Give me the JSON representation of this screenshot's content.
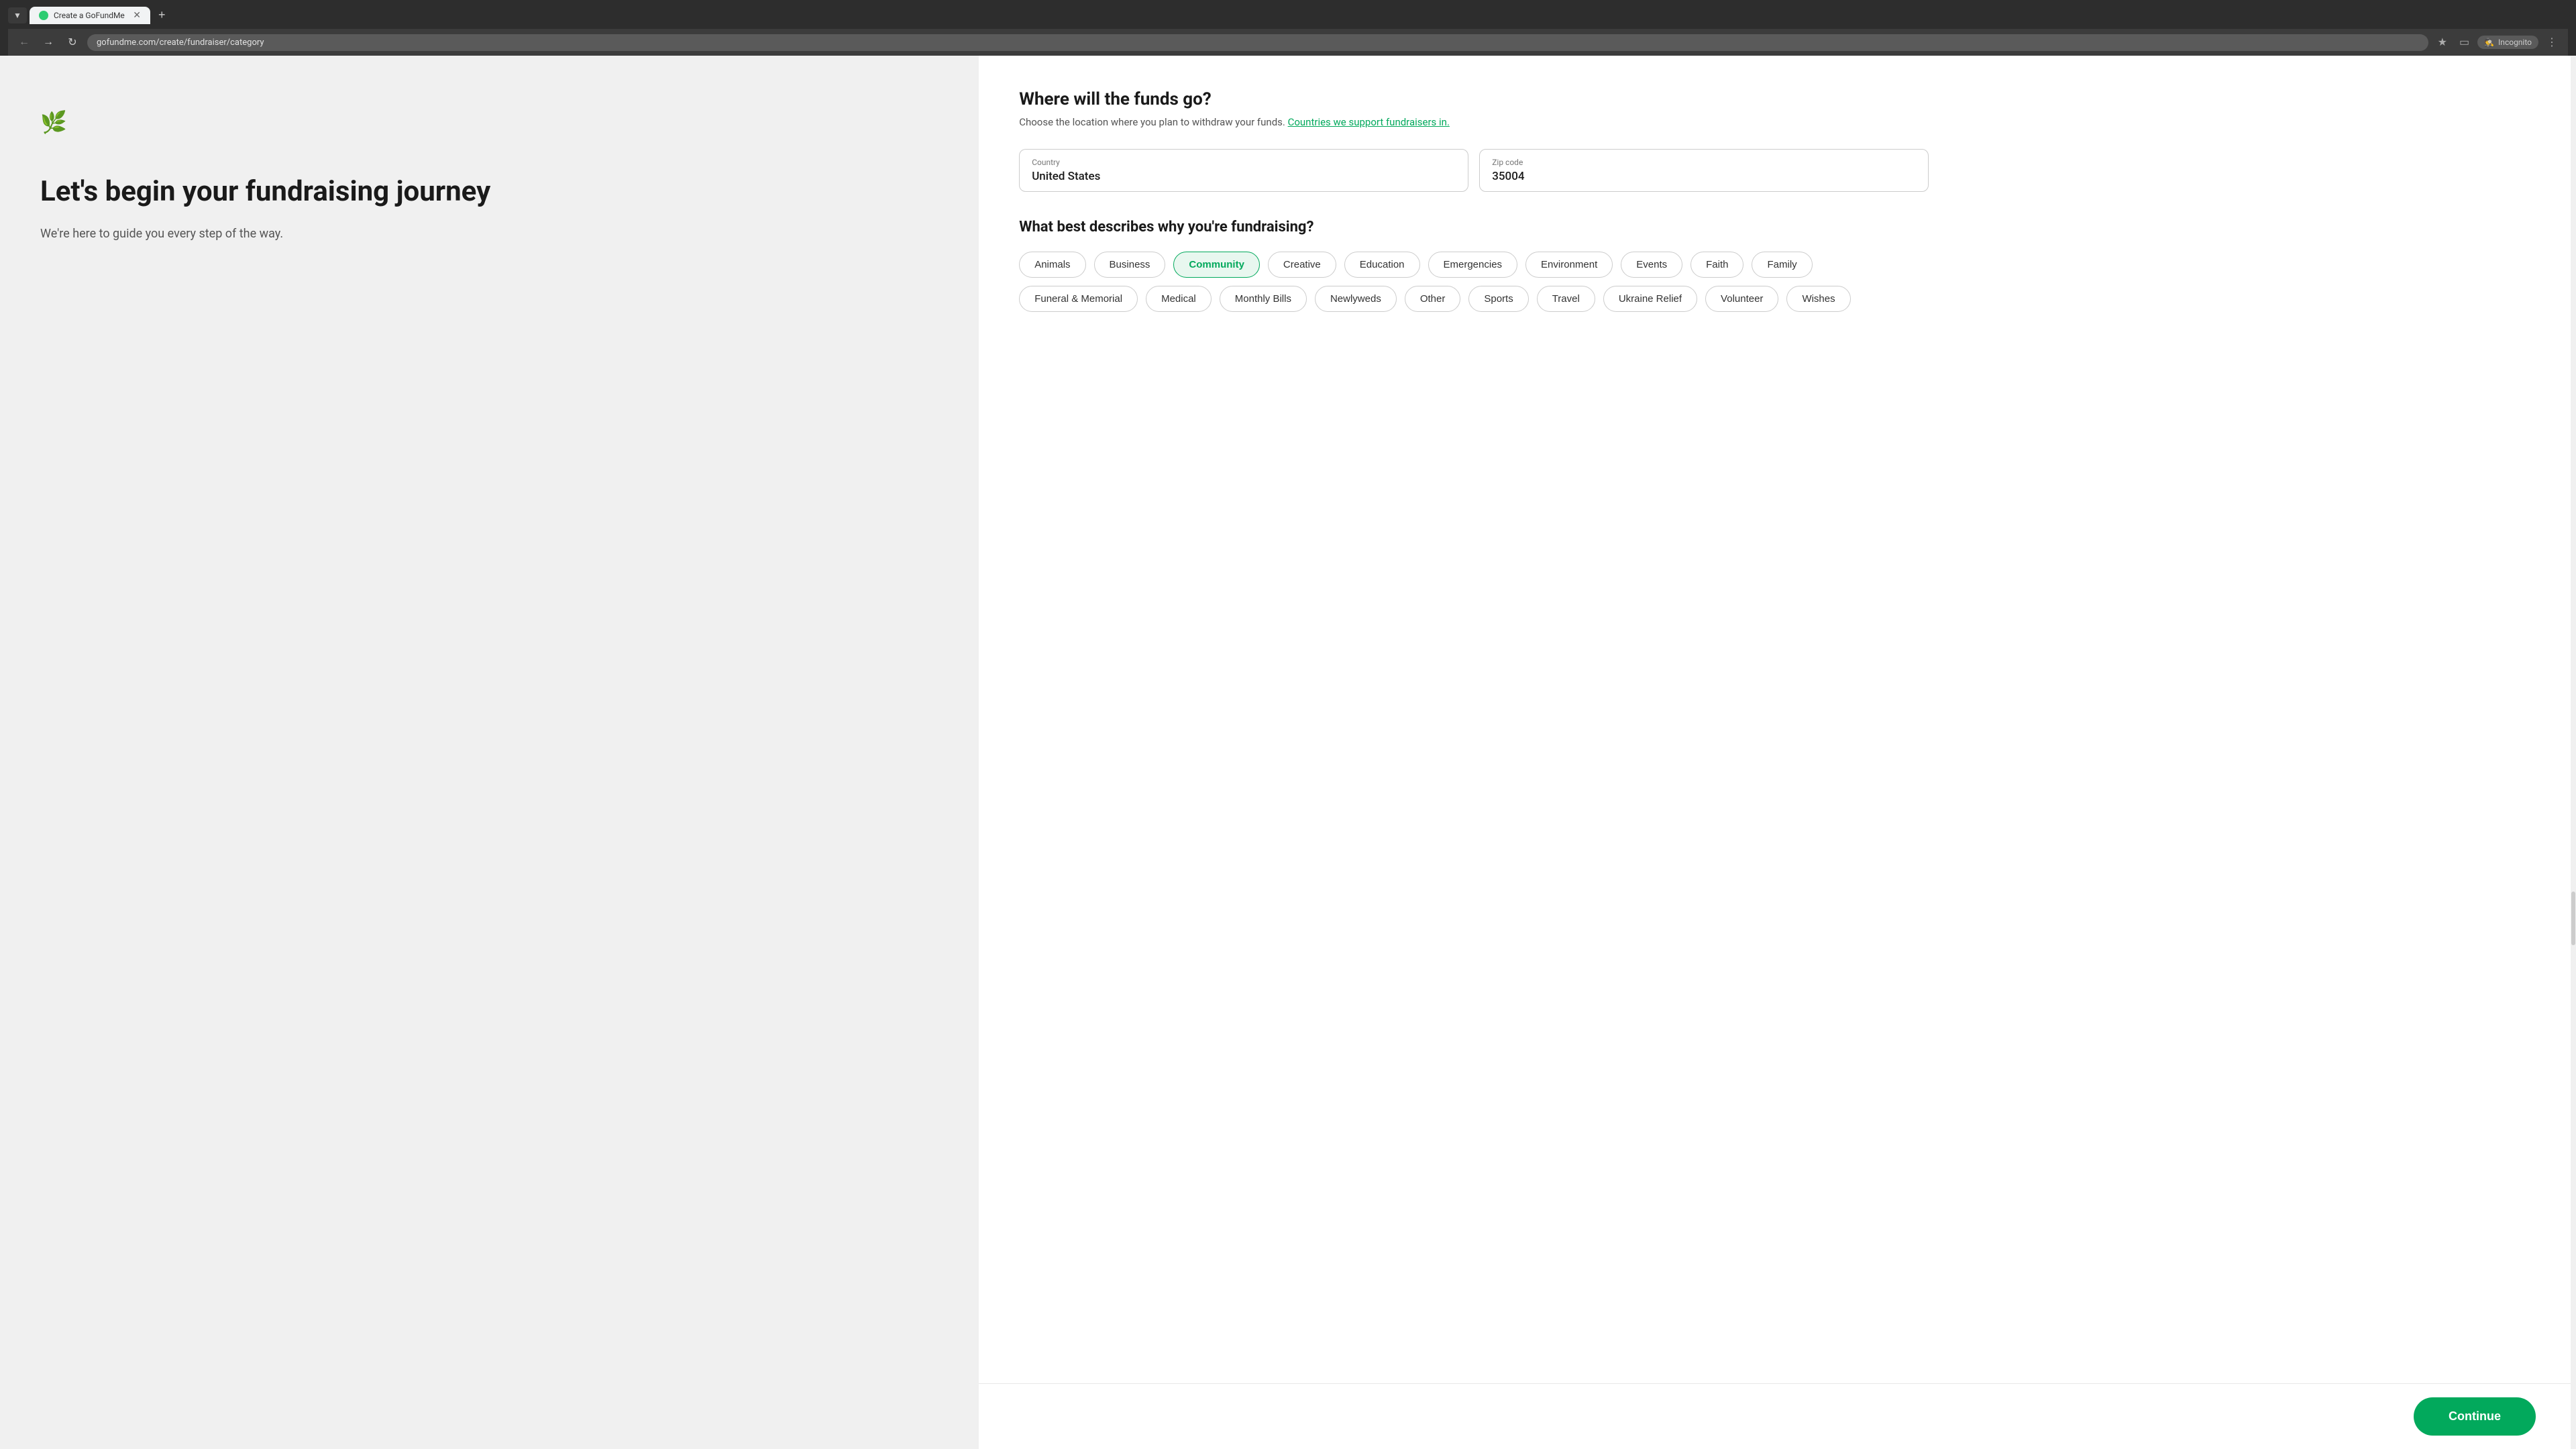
{
  "browser": {
    "tab_title": "Create a GoFundMe",
    "url": "gofundme.com/create/fundraiser/category",
    "incognito_label": "Incognito"
  },
  "left_panel": {
    "heading": "Let's begin your fundraising journey",
    "subheading": "We're here to guide you every step of the way."
  },
  "main": {
    "funds_title": "Where will the funds go?",
    "funds_desc_start": "Choose the location where you plan to withdraw your funds.",
    "funds_desc_link": "Countries we support fundraisers in.",
    "country_label": "Country",
    "country_value": "United States",
    "zip_label": "Zip code",
    "zip_value": "35004",
    "category_title": "What best describes why you're fundraising?",
    "categories": [
      {
        "id": "animals",
        "label": "Animals",
        "selected": false
      },
      {
        "id": "business",
        "label": "Business",
        "selected": false
      },
      {
        "id": "community",
        "label": "Community",
        "selected": true
      },
      {
        "id": "creative",
        "label": "Creative",
        "selected": false
      },
      {
        "id": "education",
        "label": "Education",
        "selected": false
      },
      {
        "id": "emergencies",
        "label": "Emergencies",
        "selected": false
      },
      {
        "id": "environment",
        "label": "Environment",
        "selected": false
      },
      {
        "id": "events",
        "label": "Events",
        "selected": false
      },
      {
        "id": "faith",
        "label": "Faith",
        "selected": false
      },
      {
        "id": "family",
        "label": "Family",
        "selected": false
      },
      {
        "id": "funeral",
        "label": "Funeral & Memorial",
        "selected": false
      },
      {
        "id": "medical",
        "label": "Medical",
        "selected": false
      },
      {
        "id": "monthly-bills",
        "label": "Monthly Bills",
        "selected": false
      },
      {
        "id": "newlyweds",
        "label": "Newlyweds",
        "selected": false
      },
      {
        "id": "other",
        "label": "Other",
        "selected": false
      },
      {
        "id": "sports",
        "label": "Sports",
        "selected": false
      },
      {
        "id": "travel",
        "label": "Travel",
        "selected": false
      },
      {
        "id": "ukraine-relief",
        "label": "Ukraine Relief",
        "selected": false
      },
      {
        "id": "volunteer",
        "label": "Volunteer",
        "selected": false
      },
      {
        "id": "wishes",
        "label": "Wishes",
        "selected": false
      }
    ],
    "continue_label": "Continue"
  }
}
